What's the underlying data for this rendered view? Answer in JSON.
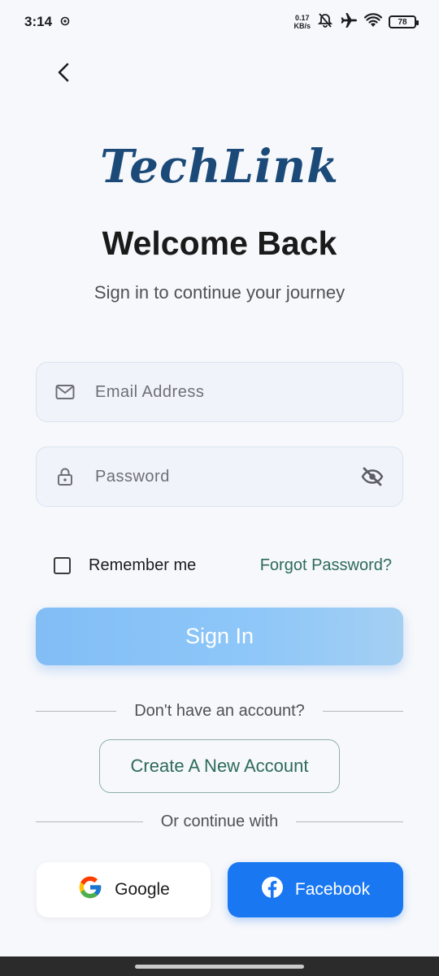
{
  "status_bar": {
    "time": "3:14",
    "net_speed_value": "0.17",
    "net_speed_unit": "KB/s",
    "battery": "78"
  },
  "logo": {
    "text": "TechLink"
  },
  "title": "Welcome Back",
  "subtitle": "Sign in to continue your journey",
  "email_field": {
    "placeholder": "Email Address",
    "icon": "mail-icon"
  },
  "password_field": {
    "placeholder": "Password",
    "icon": "lock-icon",
    "toggle_icon": "eye-off-icon"
  },
  "remember_me": {
    "label": "Remember me",
    "checked": false
  },
  "forgot_password": "Forgot Password?",
  "sign_in_button": "Sign In",
  "no_account_text": "Don't have an account?",
  "create_account_button": "Create A New Account",
  "continue_with_text": "Or continue with",
  "social": {
    "google": "Google",
    "facebook": "Facebook"
  },
  "colors": {
    "brand": "#1b4a79",
    "accent_green": "#2d6b58",
    "sign_in_gradient_start": "#82bdf6",
    "facebook_blue": "#1977f2"
  }
}
